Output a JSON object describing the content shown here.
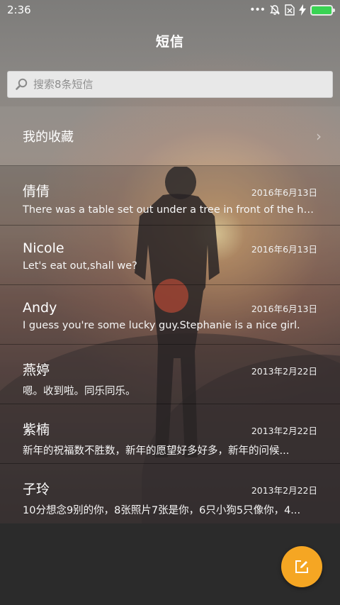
{
  "status_bar": {
    "time": "2:36",
    "icons": [
      "more-dots-icon",
      "mute-bell-icon",
      "no-sim-icon",
      "charging-bolt-icon",
      "battery-icon"
    ],
    "battery_color": "#39d353"
  },
  "header": {
    "title": "短信"
  },
  "search": {
    "placeholder": "搜索8条短信",
    "value": ""
  },
  "favorites": {
    "label": "我的收藏"
  },
  "messages": [
    {
      "name": "倩倩",
      "date": "2016年6月13日",
      "preview": "There was a table set out under a tree in front of the ho..."
    },
    {
      "name": "Nicole",
      "date": "2016年6月13日",
      "preview": "Let's eat out,shall we?"
    },
    {
      "name": "Andy",
      "date": "2016年6月13日",
      "preview": "I guess you're some lucky guy.Stephanie is a nice girl."
    },
    {
      "name": "燕婷",
      "date": "2013年2月22日",
      "preview": "嗯。收到啦。同乐同乐。"
    },
    {
      "name": "紫楠",
      "date": "2013年2月22日",
      "preview": "新年的祝福数不胜数，新年的愿望好多好多，新年的问候..."
    },
    {
      "name": "子玲",
      "date": "2013年2月22日",
      "preview": "10分想念9别的你，8张照片7张是你，6只小狗5只像你，4..."
    }
  ],
  "fab": {
    "icon": "compose-icon",
    "color": "#f5a623"
  }
}
